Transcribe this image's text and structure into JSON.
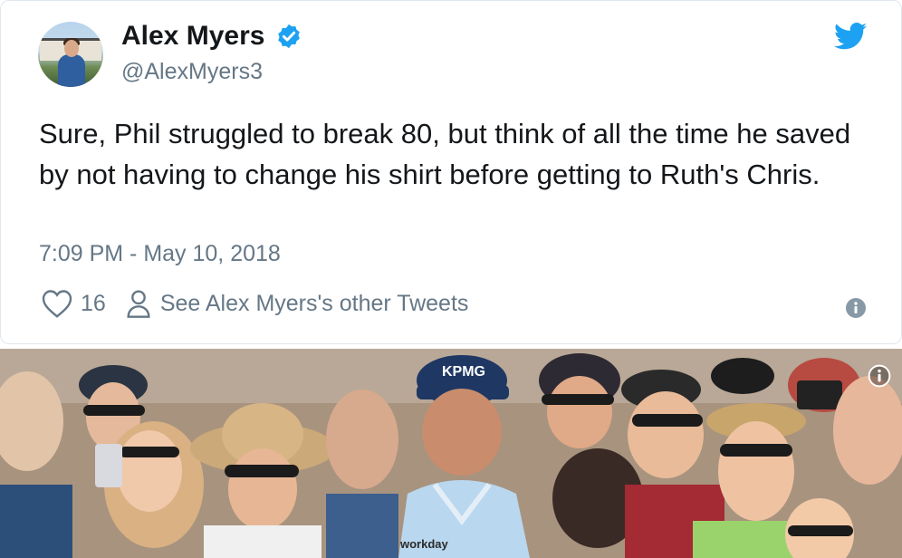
{
  "tweet": {
    "author_name": "Alex Myers",
    "author_handle": "@AlexMyers3",
    "text": "Sure, Phil struggled to break 80, but think of all the time he saved by not having to change his shirt before getting to Ruth's Chris.",
    "timestamp": "7:09 PM - May 10, 2018",
    "like_count": "16",
    "other_tweets_link": "See Alex Myers's other Tweets"
  },
  "photo": {
    "cap_text": "KPMG",
    "shirt_text": "workday"
  },
  "colors": {
    "twitter_blue": "#1da1f2",
    "text_primary": "#14171a",
    "text_secondary": "#657786"
  },
  "icons": {
    "verified": "verified-badge-icon",
    "brand": "twitter-bird-icon",
    "like": "heart-icon",
    "profile": "person-icon",
    "info": "info-icon"
  }
}
